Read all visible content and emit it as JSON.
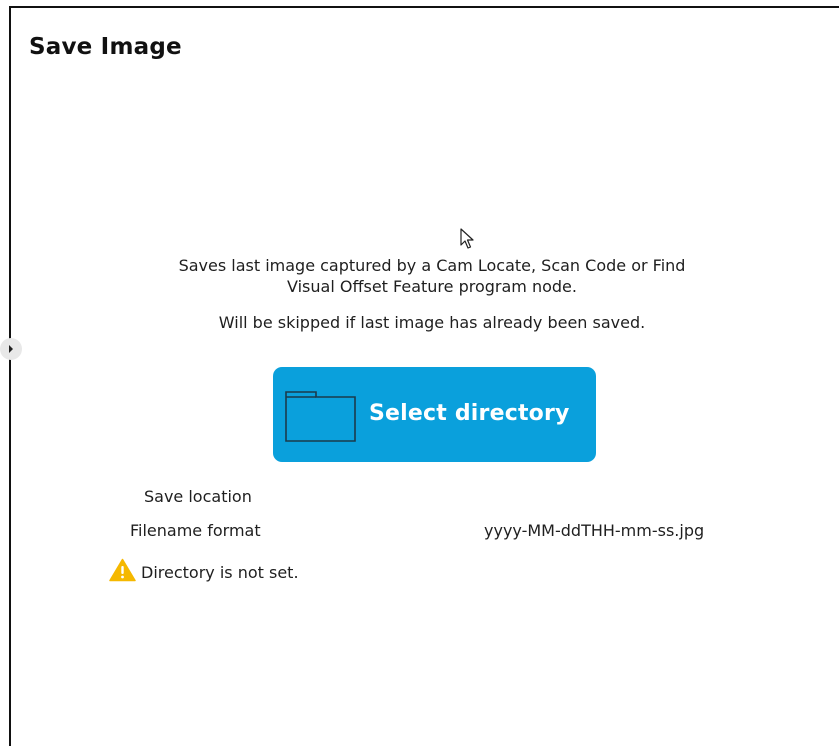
{
  "header": {
    "title": "Save Image"
  },
  "description": {
    "line1": "Saves last image captured by a Cam Locate, Scan Code or Find",
    "line2": "Visual Offset Feature program node.",
    "note": "Will be skipped if last image has already been saved."
  },
  "select_button": {
    "label": "Select directory",
    "icon": "folder-icon",
    "color": "#0aa0dc"
  },
  "fields": {
    "save_location": {
      "label": "Save location",
      "value": ""
    },
    "filename_format": {
      "label": "Filename format",
      "value": "yyyy-MM-ddTHH-mm-ss.jpg"
    }
  },
  "warning": {
    "icon": "warning-icon",
    "text": "Directory is not set.",
    "color": "#f5b800"
  },
  "side_handle": {
    "icon": "chevron-right-icon"
  },
  "cursor": {
    "icon": "mouse-pointer-icon"
  }
}
